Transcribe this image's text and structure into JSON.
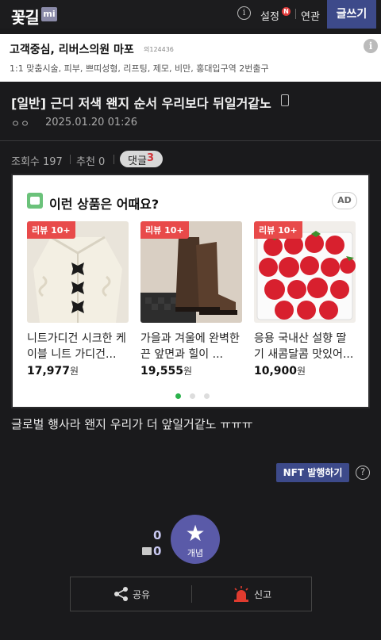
{
  "header": {
    "logo": "꽃길",
    "logo_badge": "mi",
    "info_symbol": "i",
    "settings_label": "설정",
    "settings_badge": "N",
    "related_label": "연관",
    "write_button": "글쓰기"
  },
  "top_ad": {
    "title": "고객중심, 리버스의원 마포",
    "sub": "의124436",
    "description": "1:1 맞춤시술, 피부, 쁘띠성형, 리프팅, 제모, 비만, 홍대입구역 2번출구",
    "info_symbol": "i"
  },
  "post": {
    "title": "[일반] 근디 저색 왠지 순서 우리보다 뒤일거같노",
    "author": "ㅇㅇ",
    "date": "2025.01.20 01:26",
    "views_label": "조회수 197",
    "recommend_label": "추천 0",
    "comment_label": "댓글",
    "comment_count": "3",
    "body": "글로벌 행사라 왠지 우리가 더 앞일거같노 ㅠㅠㅠ"
  },
  "product_card": {
    "heading": "이런 상품은 어때요?",
    "ad_badge": "AD",
    "review_tag": "리뷰 10+",
    "currency": "원",
    "products": [
      {
        "name": "니트가디건 시크한 케이블 니트 가디건...",
        "price": "17,977"
      },
      {
        "name": "가을과 겨울에 완벽한 끈 앞면과 힐이 ...",
        "price": "19,555"
      },
      {
        "name": "응용 국내산 설향 딸기 새콤달콤 맛있어...",
        "price": "10,900"
      }
    ],
    "page_dots": 3,
    "active_dot": 0
  },
  "nft": {
    "button": "NFT 발행하기",
    "help_symbol": "?"
  },
  "vote": {
    "recommend_count": "0",
    "fixed_count": "0",
    "button_label": "개념"
  },
  "actions": {
    "share": "공유",
    "report": "신고"
  },
  "colors": {
    "accent": "#3d4a8a",
    "recommend": "#5a5aa8",
    "review_tag": "#e84a4a",
    "active_dot": "#2bb24c"
  }
}
